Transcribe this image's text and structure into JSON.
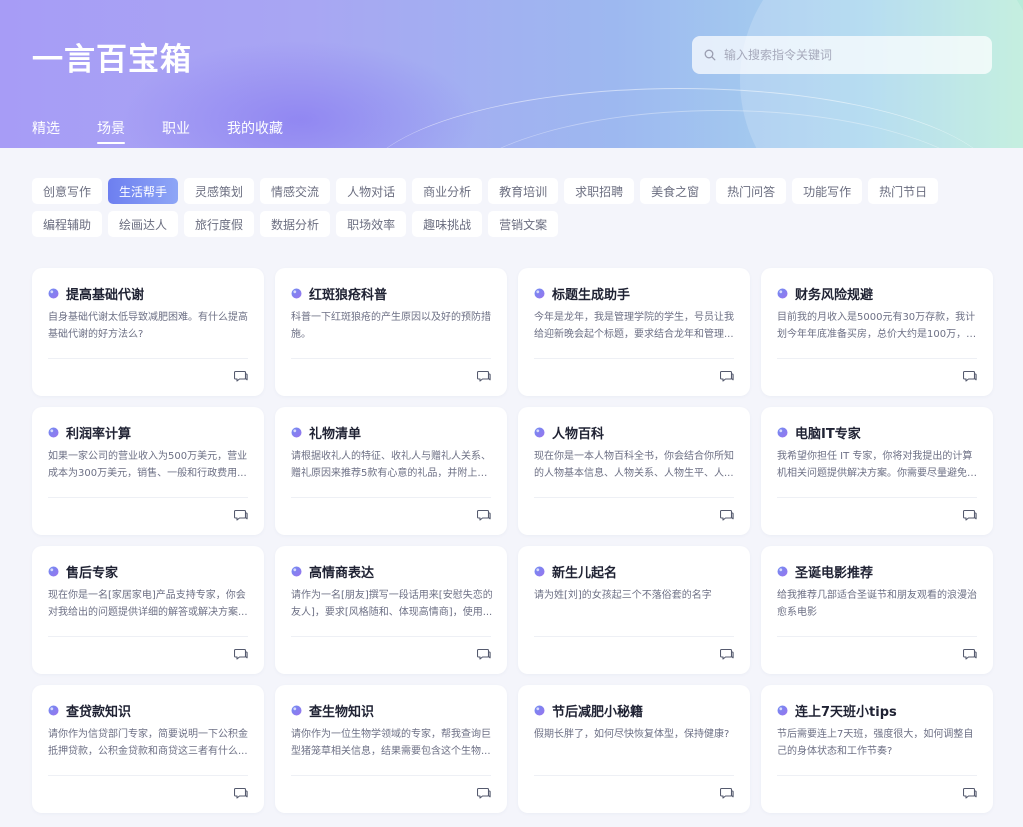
{
  "app": {
    "title": "一言百宝箱"
  },
  "search": {
    "placeholder": "输入搜索指令关键词",
    "icon": "search-icon"
  },
  "nav": {
    "tabs": [
      {
        "label": "精选",
        "active": false
      },
      {
        "label": "场景",
        "active": true
      },
      {
        "label": "职业",
        "active": false
      },
      {
        "label": "我的收藏",
        "active": false
      }
    ]
  },
  "tags": [
    {
      "label": "创意写作",
      "active": false
    },
    {
      "label": "生活帮手",
      "active": true
    },
    {
      "label": "灵感策划",
      "active": false
    },
    {
      "label": "情感交流",
      "active": false
    },
    {
      "label": "人物对话",
      "active": false
    },
    {
      "label": "商业分析",
      "active": false
    },
    {
      "label": "教育培训",
      "active": false
    },
    {
      "label": "求职招聘",
      "active": false
    },
    {
      "label": "美食之窗",
      "active": false
    },
    {
      "label": "热门问答",
      "active": false
    },
    {
      "label": "功能写作",
      "active": false
    },
    {
      "label": "热门节日",
      "active": false
    },
    {
      "label": "编程辅助",
      "active": false
    },
    {
      "label": "绘画达人",
      "active": false
    },
    {
      "label": "旅行度假",
      "active": false
    },
    {
      "label": "数据分析",
      "active": false
    },
    {
      "label": "职场效率",
      "active": false
    },
    {
      "label": "趣味挑战",
      "active": false
    },
    {
      "label": "营销文案",
      "active": false
    }
  ],
  "cards": [
    {
      "title": "提高基础代谢",
      "desc": "自身基础代谢太低导致减肥困难。有什么提高基础代谢的好方法么?"
    },
    {
      "title": "红斑狼疮科普",
      "desc": "科普一下红斑狼疮的产生原因以及好的预防措施。"
    },
    {
      "title": "标题生成助手",
      "desc": "今年是龙年，我是管理学院的学生，号员让我给迎新晚会起个标题，要求结合龙年和管理..."
    },
    {
      "title": "财务风险规避",
      "desc": "目前我的月收入是5000元有30万存款，我计划今年年底准备买房，总价大约是100万，请..."
    },
    {
      "title": "利润率计算",
      "desc": "如果一家公司的营业收入为500万美元，营业成本为300万美元，销售、一般和行政费用..."
    },
    {
      "title": "礼物清单",
      "desc": "请根据收礼人的特征、收礼人与赠礼人关系、赠礼原因来推荐5款有心意的礼品，并附上推..."
    },
    {
      "title": "人物百科",
      "desc": "现在你是一本人物百科全书，你会结合你所知的人物基本信息、人物关系、人物生平、人..."
    },
    {
      "title": "电脑IT专家",
      "desc": "我希望你担任 IT 专家，你将对我提出的计算机相关问题提供解决方案。你需要尽量避免过..."
    },
    {
      "title": "售后专家",
      "desc": "现在你是一名[家居家电]产品支持专家，你会对我给出的问题提供详细的解答或解决方案..."
    },
    {
      "title": "高情商表达",
      "desc": "请作为一名[朋友]撰写一段话用来[安慰失恋的友人]，要求[风格随和、体现高情商]，使用..."
    },
    {
      "title": "新生儿起名",
      "desc": "请为姓[刘]的女孩起三个不落俗套的名字"
    },
    {
      "title": "圣诞电影推荐",
      "desc": "给我推荐几部适合圣诞节和朋友观看的浪漫治愈系电影"
    },
    {
      "title": "查贷款知识",
      "desc": "请你作为信贷部门专家，简要说明一下公积金抵押贷款，公积金贷款和商贷这三者有什么..."
    },
    {
      "title": "查生物知识",
      "desc": "请你作为一位生物学领域的专家，帮我查询巨型猪笼草相关信息，结果需要包含这个生物..."
    },
    {
      "title": "节后减肥小秘籍",
      "desc": "假期长胖了，如何尽快恢复体型，保持健康?"
    },
    {
      "title": "连上7天班小tips",
      "desc": "节后需要连上7天班，强度很大，如何调整自己的身体状态和工作节奏?"
    }
  ],
  "icons": {
    "card_title": "sparkle-dot-icon",
    "card_action": "chat-icon"
  },
  "colors": {
    "accent": "#6d7ff0",
    "accent_light": "#8ea6f6",
    "dot_gradient_start": "#6f8cf2",
    "dot_gradient_end": "#9a74ee"
  }
}
